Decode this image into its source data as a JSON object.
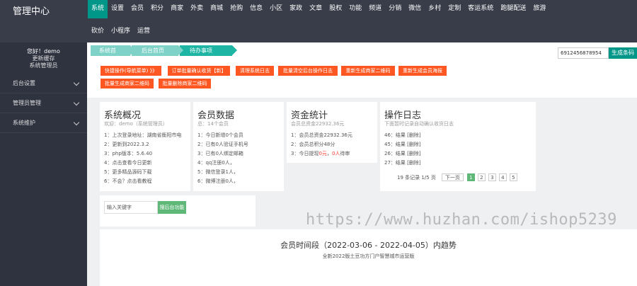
{
  "header": {
    "logo": "管理中心",
    "nav_row1": [
      "系统",
      "设置",
      "会员",
      "积分",
      "商家",
      "外卖",
      "商城",
      "抢购",
      "信息",
      "小区",
      "家政",
      "文章",
      "股权",
      "功能",
      "频道",
      "分销",
      "微信",
      "乡村",
      "定制",
      "客运系统",
      "跑腿配送",
      "旅游"
    ],
    "nav_row2": [
      "砍价",
      "小程序",
      "运营"
    ],
    "active_nav": "系统"
  },
  "sidebar": {
    "greeting": "您好！demo",
    "update_cache": "更新缓存",
    "role": "系统管理员",
    "items": [
      "后台设置",
      "管理员管理",
      "系统维护"
    ]
  },
  "breadcrumb": [
    "系统首页",
    "后台首页",
    "待办事项"
  ],
  "search_top": {
    "value": "6912456878954",
    "button": "生成条码"
  },
  "action_buttons": {
    "row1": [
      "快捷操作(导航菜单)  》》",
      "订单批量确认收货【新】",
      "清理系统日志",
      "批量清空后台操作日志",
      "重新生成商家二维码",
      "重新生成会员海报"
    ],
    "row2": [
      "批量生成商家二维码",
      "批量删除商家二维码"
    ]
  },
  "cards": {
    "system": {
      "title": "系统概况",
      "sub": "欢迎：demo（系统管理员）",
      "lines": [
        "1：上次登录地址：湖南省衡阳市电",
        "2：更新到2022.3.2",
        "3：php版本：5.6.40",
        "4：点击查看今日更新",
        "5：更多精品源码下载",
        "6：不会？点击看教程"
      ]
    },
    "members": {
      "title": "会员数据",
      "sub": "总：14个会员",
      "lines": [
        "1：今日新增0个会员",
        "2：已有0人验证手机号",
        "3：已有0人绑定邮箱",
        "4：qq注册0人，",
        "5：微信登录1人，",
        "6：微博注册0人，"
      ]
    },
    "funds": {
      "title": "资金统计",
      "sub": "会员总资金22932.36元",
      "lines": [
        {
          "pre": "1：会员总资金22932.36元",
          "red": "",
          "post": "",
          "red2": "",
          "post2": ""
        },
        {
          "pre": "2：会员总积分48分",
          "red": "",
          "post": "",
          "red2": "",
          "post2": ""
        },
        {
          "pre": "3：今日提现",
          "red": "0元",
          "post": "，",
          "red2": "0人",
          "post2": "待审"
        }
      ]
    },
    "logs": {
      "title": "操作日志",
      "sub": "下面暂时记录自动确认收货日志",
      "lines": [
        "46：结果 [删除]",
        "45：结果 [删除]",
        "26：结果 [删除]",
        "27：结果 [删除]"
      ],
      "pager": {
        "total": "19 条记录 1/5 页",
        "next": "下一页",
        "pages": [
          "1",
          "2",
          "3",
          "4",
          "5"
        ],
        "current": "1"
      }
    }
  },
  "keyword": {
    "placeholder": "输入关键字",
    "button": "搜后台功能"
  },
  "chart_panel": {
    "title": "会员时间段（2022-03-06 - 2022-04-05）内趋势",
    "subtitle": "全新2022版土豆功方门户智慧城市运营版"
  },
  "watermark": "https://www.huzhan.com/ishop5239"
}
